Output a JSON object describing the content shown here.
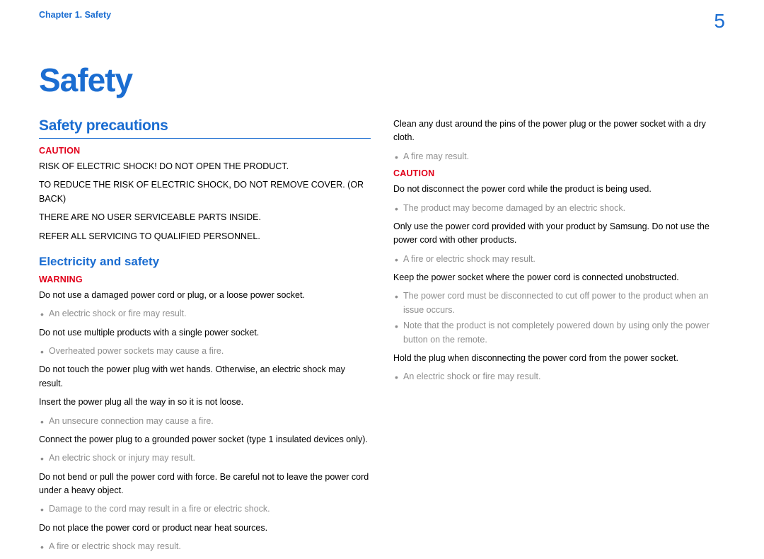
{
  "header": {
    "chapter": "Chapter 1. Safety",
    "page": "5"
  },
  "title": "Safety",
  "section1": {
    "heading": "Safety precautions",
    "label": "CAUTION",
    "p1": "RISK OF ELECTRIC SHOCK! DO NOT OPEN THE PRODUCT.",
    "p2": "TO REDUCE THE RISK OF ELECTRIC SHOCK, DO NOT REMOVE COVER. (OR BACK)",
    "p3": "THERE ARE NO USER SERVICEABLE PARTS INSIDE.",
    "p4": "REFER ALL SERVICING TO QUALIFIED PERSONNEL."
  },
  "section2": {
    "heading": "Electricity and safety",
    "label": "WARNING",
    "b1": {
      "t": "Do not use a damaged power cord or plug, or a loose power socket.",
      "n": "An electric shock or fire may result."
    },
    "b2": {
      "t": "Do not use multiple products with a single power socket.",
      "n": "Overheated power sockets may cause a fire."
    },
    "b3": {
      "t": "Do not touch the power plug with wet hands. Otherwise, an electric shock may result."
    },
    "b4": {
      "t": "Insert the power plug all the way in so it is not loose.",
      "n": "An unsecure connection may cause a fire."
    },
    "b5": {
      "t": "Connect the power plug to a grounded power socket (type 1 insulated devices only).",
      "n": "An electric shock or injury may result."
    },
    "b6": {
      "t": "Do not bend or pull the power cord with force. Be careful not to leave the power cord under a heavy object.",
      "n": "Damage to the cord may result in a fire or electric shock."
    },
    "b7": {
      "t": "Do not place the power cord or product near heat sources.",
      "n": "A fire or electric shock may result."
    }
  },
  "right": {
    "b1": {
      "t": "Clean any dust around the pins of the power plug or the power socket with a dry cloth.",
      "n": "A fire may result."
    },
    "label": "CAUTION",
    "b2": {
      "t": "Do not disconnect the power cord while the product is being used.",
      "n": "The product may become damaged by an electric shock."
    },
    "b3": {
      "t": "Only use the power cord provided with your product by Samsung. Do not use the power cord with other products.",
      "n": "A fire or electric shock may result."
    },
    "b4": {
      "t": "Keep the power socket where the power cord is connected unobstructed.",
      "n1": "The power cord must be disconnected to cut off power to the product when an issue occurs.",
      "n2": "Note that the product is not completely powered down by using only the power button on the remote."
    },
    "b5": {
      "t": "Hold the plug when disconnecting the power cord from the power socket.",
      "n": "An electric shock or fire may result."
    }
  }
}
